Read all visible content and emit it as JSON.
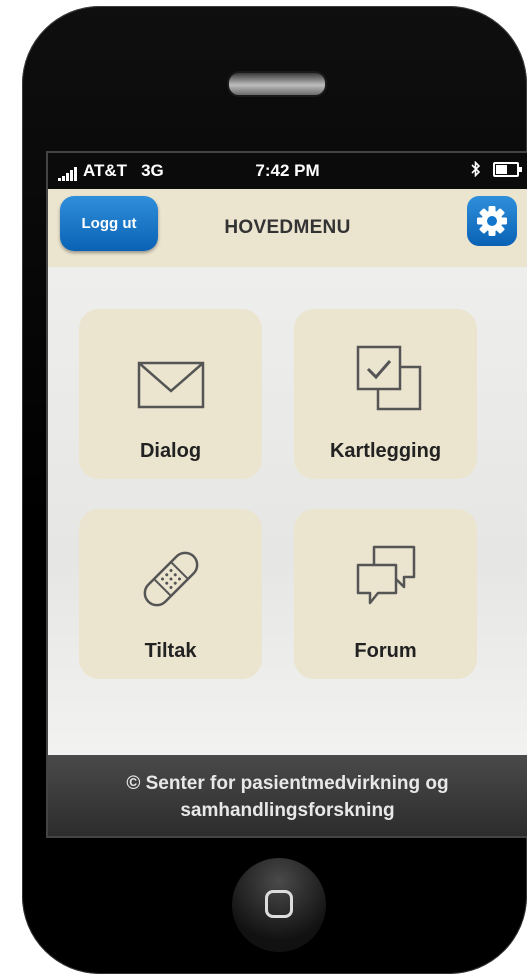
{
  "status_bar": {
    "carrier": "AT&T",
    "network": "3G",
    "time": "7:42 PM"
  },
  "header": {
    "logout_label": "Logg ut",
    "title": "HOVEDMENU"
  },
  "menu": {
    "items": [
      {
        "label": "Dialog",
        "icon": "envelope-icon"
      },
      {
        "label": "Kartlegging",
        "icon": "checklist-icon"
      },
      {
        "label": "Tiltak",
        "icon": "bandage-icon"
      },
      {
        "label": "Forum",
        "icon": "chat-bubbles-icon"
      }
    ]
  },
  "footer": {
    "line1": "© Senter for pasientmedvirkning og",
    "line2": "samhandlingsforskning"
  },
  "colors": {
    "accent": "#1176cc",
    "tile": "#ebe5cf",
    "header": "#ebe4cf"
  }
}
